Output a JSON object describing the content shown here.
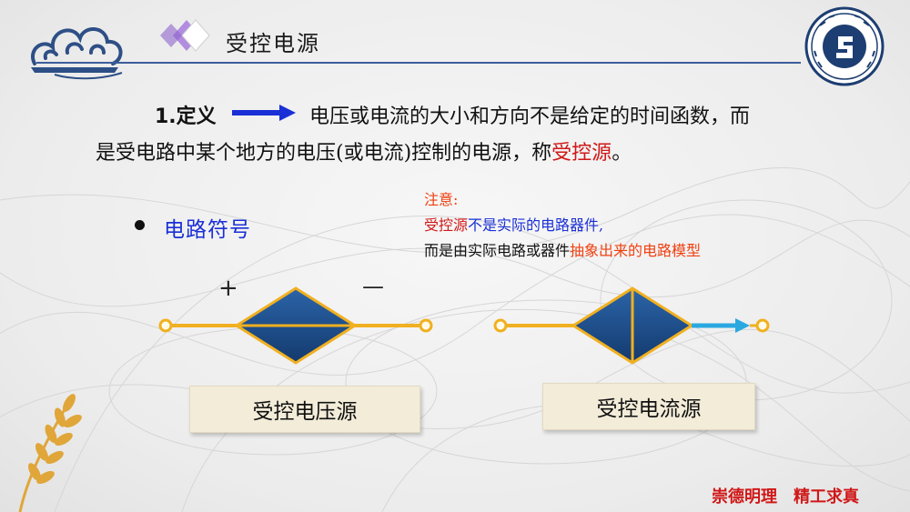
{
  "header": {
    "title": "受控电源"
  },
  "definition": {
    "label": "1.定义",
    "text_line1": "电压或电流的大小和方向不是给定的时间函数，而",
    "text_line2_prefix": "是受电路中某个地方的电压(或电流)控制的电源，称",
    "text_line2_highlight": "受控源",
    "text_line2_suffix": "。"
  },
  "symbol_section": {
    "label": "电路符号",
    "plus": "+",
    "minus": "—"
  },
  "note": {
    "title": "注意:",
    "line1_highlight": "受控源",
    "line1_rest": "不是实际的电路器件,",
    "line2_prefix": "而是由实际电路或器件",
    "line2_highlight": "抽象出来的电路模型"
  },
  "sources": {
    "voltage_label": "受控电压源",
    "current_label": "受控电流源"
  },
  "footer": {
    "motto_part1": "崇德明理",
    "motto_part2": "精工求真"
  },
  "colors": {
    "header_line": "#3b5e9a",
    "diamond_fill": "#1e4d8c",
    "wire": "#f0b020",
    "arrow": "#2aa8e0",
    "highlight_red": "#d01818",
    "highlight_blue": "#1a2fd6"
  }
}
